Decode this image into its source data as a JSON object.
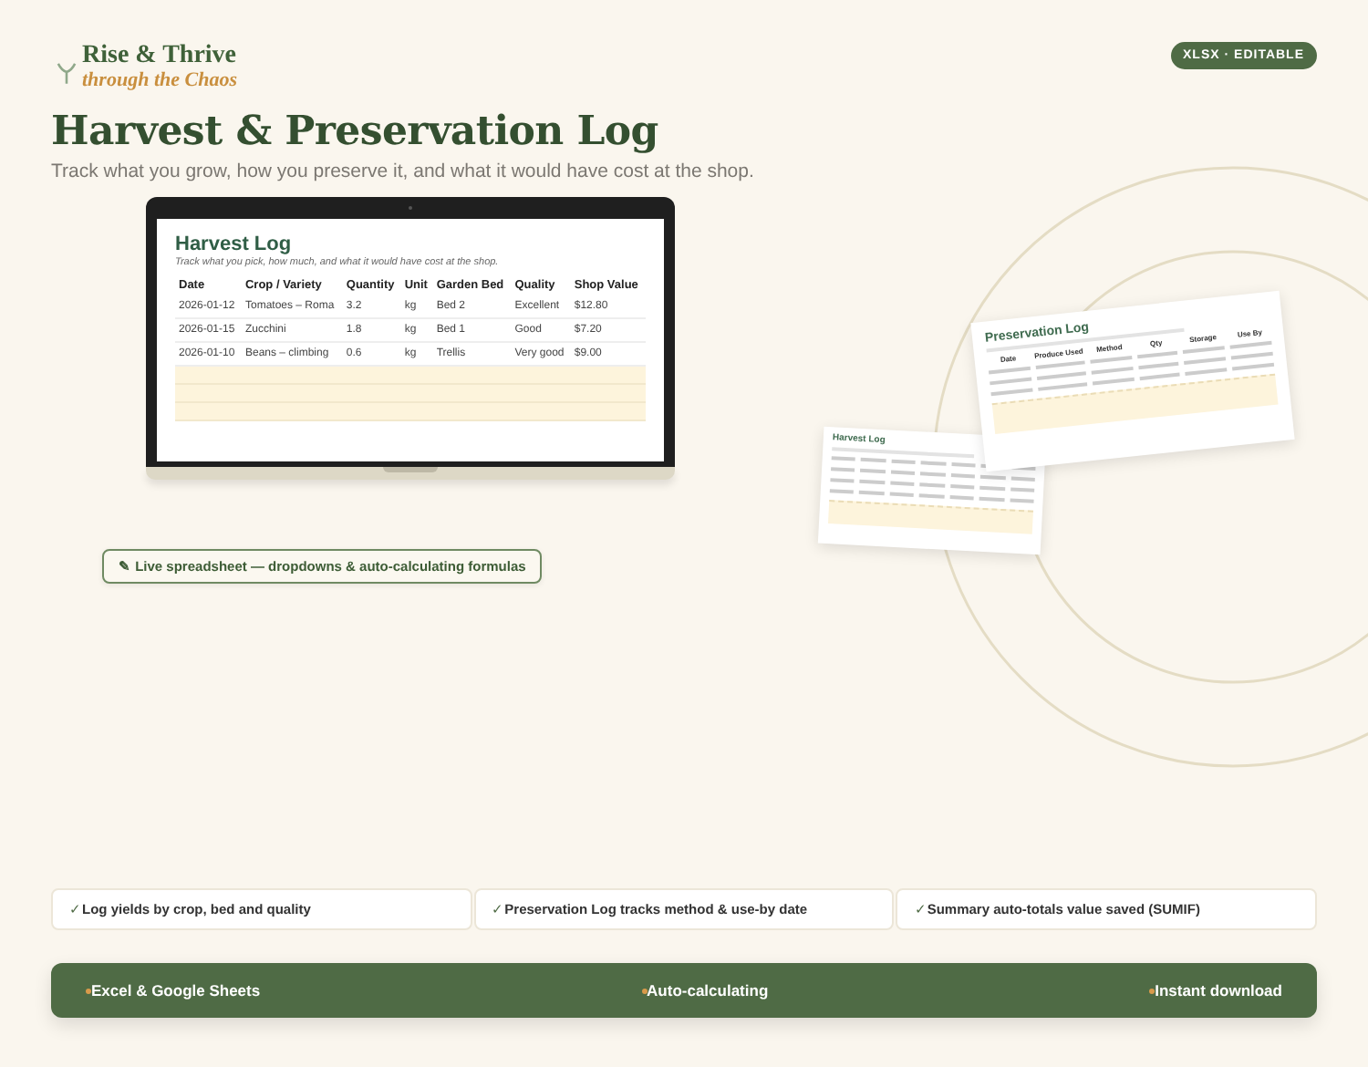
{
  "brand": {
    "name": "Rise & Thrive",
    "tagline": "through the Chaos"
  },
  "format_badge": "XLSX · EDITABLE",
  "title": "Harvest & Preservation Log",
  "subtitle": "Track what you grow, how you preserve it, and what it would have cost at the shop.",
  "laptop_sheet": {
    "title": "Harvest Log",
    "subtitle": "Track what you pick, how much, and what it would have cost at the shop.",
    "columns": [
      "Date",
      "Crop / Variety",
      "Quantity",
      "Unit",
      "Garden Bed",
      "Quality",
      "Shop Value"
    ],
    "rows": [
      [
        "2026-01-12",
        "Tomatoes – Roma",
        "3.2",
        "kg",
        "Bed 2",
        "Excellent",
        "$12.80"
      ],
      [
        "2026-01-15",
        "Zucchini",
        "1.8",
        "kg",
        "Bed 1",
        "Good",
        "$7.20"
      ],
      [
        "2026-01-10",
        "Beans – climbing",
        "0.6",
        "kg",
        "Trellis",
        "Very good",
        "$9.00"
      ]
    ]
  },
  "preservation_preview": {
    "title": "Preservation Log",
    "columns": [
      "Date",
      "Produce Used",
      "Method",
      "Qty",
      "Storage",
      "Use By"
    ]
  },
  "harvest_preview": {
    "title": "Harvest Log"
  },
  "live_note": "✎ Live spreadsheet — dropdowns & auto-calculating formulas",
  "features": [
    {
      "check": "✓",
      "text": "Log yields by crop, bed and quality"
    },
    {
      "check": "✓",
      "text": "Preservation Log tracks method & use-by date"
    },
    {
      "check": "✓",
      "text": "Summary auto-totals value saved (SUMIF)"
    }
  ],
  "highlights": [
    "Excel & Google Sheets",
    "Auto-calculating",
    "Instant download"
  ]
}
